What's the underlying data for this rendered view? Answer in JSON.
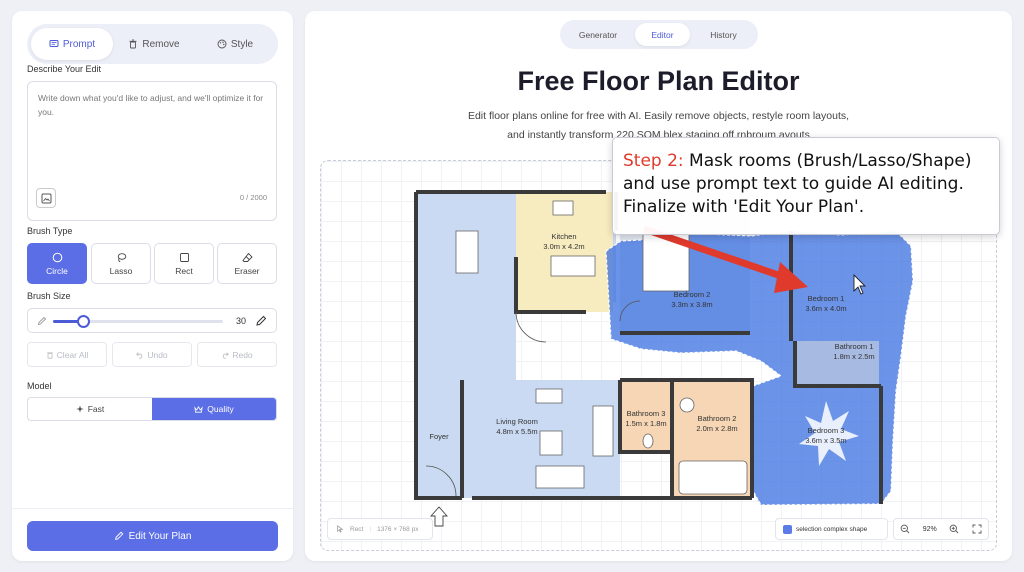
{
  "left_panel": {
    "tabs": [
      {
        "label": "Prompt",
        "active": true,
        "icon": "chat-icon"
      },
      {
        "label": "Remove",
        "active": false,
        "icon": "trash-icon"
      },
      {
        "label": "Style",
        "active": false,
        "icon": "palette-icon"
      }
    ],
    "describe_label": "Describe Your Edit",
    "textarea_placeholder": "Write down what you'd like to adjust, and we'll optimize it for you.",
    "char_count": "0 / 2000",
    "brush_type_label": "Brush Type",
    "brush_types": [
      {
        "label": "Circle",
        "active": true,
        "icon": "circle-icon"
      },
      {
        "label": "Lasso",
        "active": false,
        "icon": "lasso-icon"
      },
      {
        "label": "Rect",
        "active": false,
        "icon": "square-icon"
      },
      {
        "label": "Eraser",
        "active": false,
        "icon": "eraser-icon"
      }
    ],
    "brush_size_label": "Brush Size",
    "brush_size": {
      "value": "30",
      "fraction": 0.18
    },
    "actions": [
      {
        "label": "Clear All",
        "icon": "trash-icon"
      },
      {
        "label": "Undo",
        "icon": "undo-icon"
      },
      {
        "label": "Redo",
        "icon": "redo-icon"
      }
    ],
    "model_label": "Model",
    "model_options": [
      {
        "label": "Fast",
        "selected": false,
        "icon": "sparkle-icon"
      },
      {
        "label": "Quality",
        "selected": true,
        "icon": "crown-icon"
      }
    ],
    "edit_button": "Edit Your Plan"
  },
  "right_panel": {
    "tabs": [
      {
        "label": "Generator",
        "active": false
      },
      {
        "label": "Editor",
        "active": true
      },
      {
        "label": "History",
        "active": false
      }
    ],
    "title": "Free Floor Plan Editor",
    "subtitle_line1": "Edit floor plans online for free with AI. Easily remove objects, restyle room layouts,",
    "subtitle_line2": "and instantly transform 220 SQM blex staging off rnbroum ayouts",
    "rooms": [
      {
        "name": "Kitchen",
        "size": "3.0m x 4.2m"
      },
      {
        "name": "Bedroom 2",
        "size": "3.3m x 3.8m"
      },
      {
        "name": "Bedroom 1",
        "size": "3.6m x 4.0m"
      },
      {
        "name": "Bathroom 1",
        "size": "1.8m x 2.5m"
      },
      {
        "name": "Bathroom 3",
        "size": "1.5m x 1.8m"
      },
      {
        "name": "Bathroom 2",
        "size": "2.0m x 2.8m"
      },
      {
        "name": "Living Room",
        "size": "4.8m x 5.5m"
      },
      {
        "name": "Bedroom 3",
        "size": "3.6m x 3.5m"
      },
      {
        "name": "Foyer",
        "size": ""
      }
    ],
    "canvas_tool": "Rect",
    "canvas_dims": "1376 × 768 px",
    "legend_label": "selection complex shape",
    "zoom_level": "92%",
    "callout": {
      "step": "Step 2:",
      "text1": " Mask rooms (Brush/Lasso/Shape)",
      "text2": "and use prompt text to guide AI editing.",
      "text3": "Finalize with 'Edit Your Plan'."
    },
    "colors": {
      "accent": "#5b6ee6",
      "mask": "#3a6fe0",
      "arrow": "#e03a2c",
      "kitchen": "#f7ebc0",
      "bathroom": "#f6d6b4",
      "living": "#c9daf2"
    }
  }
}
